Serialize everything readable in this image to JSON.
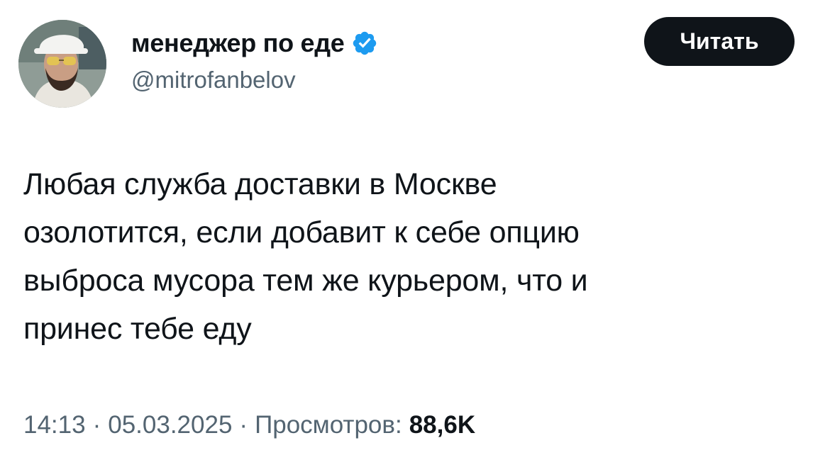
{
  "author": {
    "display_name": "менеджер по еде",
    "handle": "@mitrofanbelov",
    "verified": true,
    "verified_badge_color": "#1d9bf0"
  },
  "follow_button": {
    "label": "Читать"
  },
  "tweet": {
    "text": "Любая служба доставки в Москве\nозолотится, если добавит к себе опцию\nвыброса мусора тем же курьером, что и\nпринес тебе еду"
  },
  "meta": {
    "time": "14:13",
    "separator": "·",
    "date": "05.03.2025",
    "views_label": "Просмотров:",
    "views_count": "88,6K"
  },
  "colors": {
    "text_primary": "#0f1419",
    "text_secondary": "#536471",
    "button_background": "#0f1419"
  }
}
